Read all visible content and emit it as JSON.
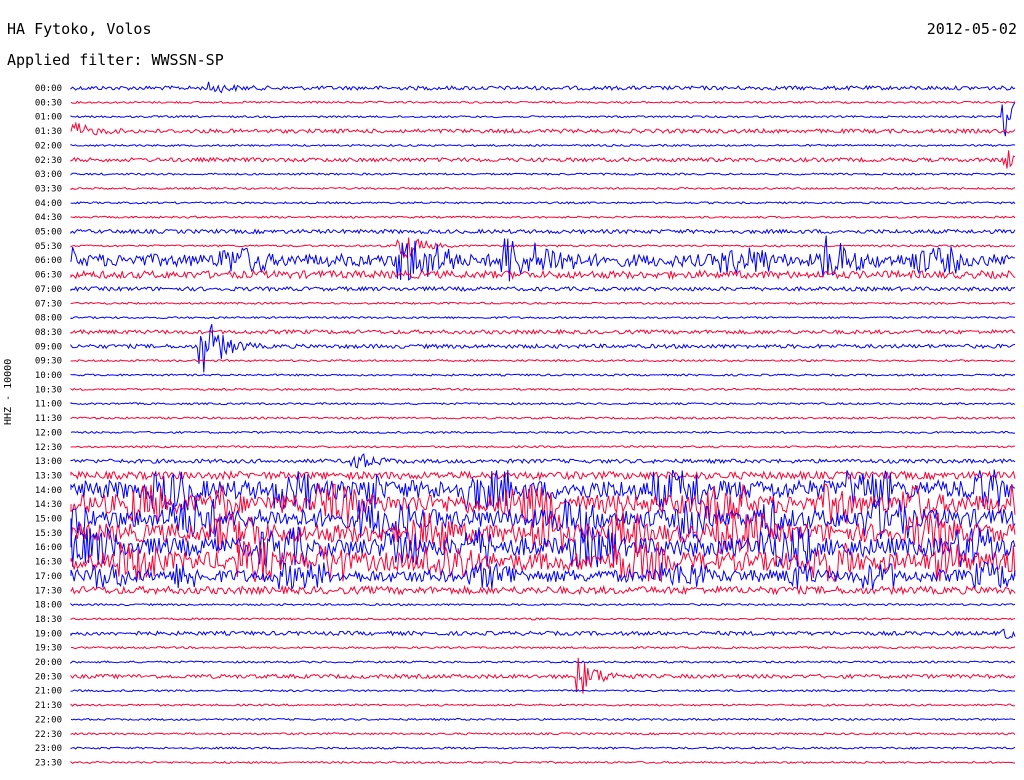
{
  "header": {
    "station": "HA Fytoko, Volos",
    "filter_label": "Applied filter: WWSSN-SP",
    "date": "2012-05-02",
    "channel_label": "HHZ - 10000"
  },
  "colors": {
    "even_row": "#0000ff",
    "odd_row": "#ff0033"
  },
  "chart_data": {
    "type": "line",
    "title": "HA Fytoko, Volos",
    "subtitle": "Applied filter: WWSSN-SP",
    "ylabel": "HHZ - 10000",
    "xlabel": "",
    "grid": false,
    "legend": "none",
    "categories": [
      "00:00",
      "00:30",
      "01:00",
      "01:30",
      "02:00",
      "02:30",
      "03:00",
      "03:30",
      "04:00",
      "04:30",
      "05:00",
      "05:30",
      "06:00",
      "06:30",
      "07:00",
      "07:30",
      "08:00",
      "08:30",
      "09:00",
      "09:30",
      "10:00",
      "10:30",
      "11:00",
      "11:30",
      "12:00",
      "12:30",
      "13:00",
      "13:30",
      "14:00",
      "14:30",
      "15:00",
      "15:30",
      "16:00",
      "16:30",
      "17:00",
      "17:30",
      "18:00",
      "18:30",
      "19:00",
      "19:30",
      "20:00",
      "20:30",
      "21:00",
      "21:30",
      "22:00",
      "22:30",
      "23:00",
      "23:30"
    ],
    "activity_level": [
      2,
      1,
      1,
      2,
      1,
      2,
      1,
      1,
      1,
      1,
      2,
      1,
      4,
      3,
      2,
      1,
      1,
      2,
      2,
      1,
      1,
      1,
      1,
      1,
      1,
      1,
      2,
      3,
      5,
      5,
      5,
      5,
      5,
      5,
      4,
      3,
      1,
      1,
      2,
      1,
      1,
      2,
      1,
      1,
      1,
      1,
      1,
      1
    ],
    "events": [
      {
        "row": "00:00",
        "x_fraction": 0.15,
        "strength": 2
      },
      {
        "row": "01:00",
        "x_fraction": 0.99,
        "strength": 5
      },
      {
        "row": "01:30",
        "x_fraction": 0.0,
        "strength": 3
      },
      {
        "row": "02:30",
        "x_fraction": 0.99,
        "strength": 3
      },
      {
        "row": "05:30",
        "x_fraction": 0.35,
        "strength": 4
      },
      {
        "row": "06:00",
        "x_fraction": 0.35,
        "strength": 5
      },
      {
        "row": "06:00",
        "x_fraction": 0.46,
        "strength": 5
      },
      {
        "row": "06:00",
        "x_fraction": 0.8,
        "strength": 5
      },
      {
        "row": "09:00",
        "x_fraction": 0.14,
        "strength": 4
      },
      {
        "row": "09:00",
        "x_fraction": 0.14,
        "strength": 4
      },
      {
        "row": "13:00",
        "x_fraction": 0.3,
        "strength": 3
      },
      {
        "row": "20:30",
        "x_fraction": 0.54,
        "strength": 4
      },
      {
        "row": "19:00",
        "x_fraction": 0.99,
        "strength": 2
      }
    ]
  }
}
